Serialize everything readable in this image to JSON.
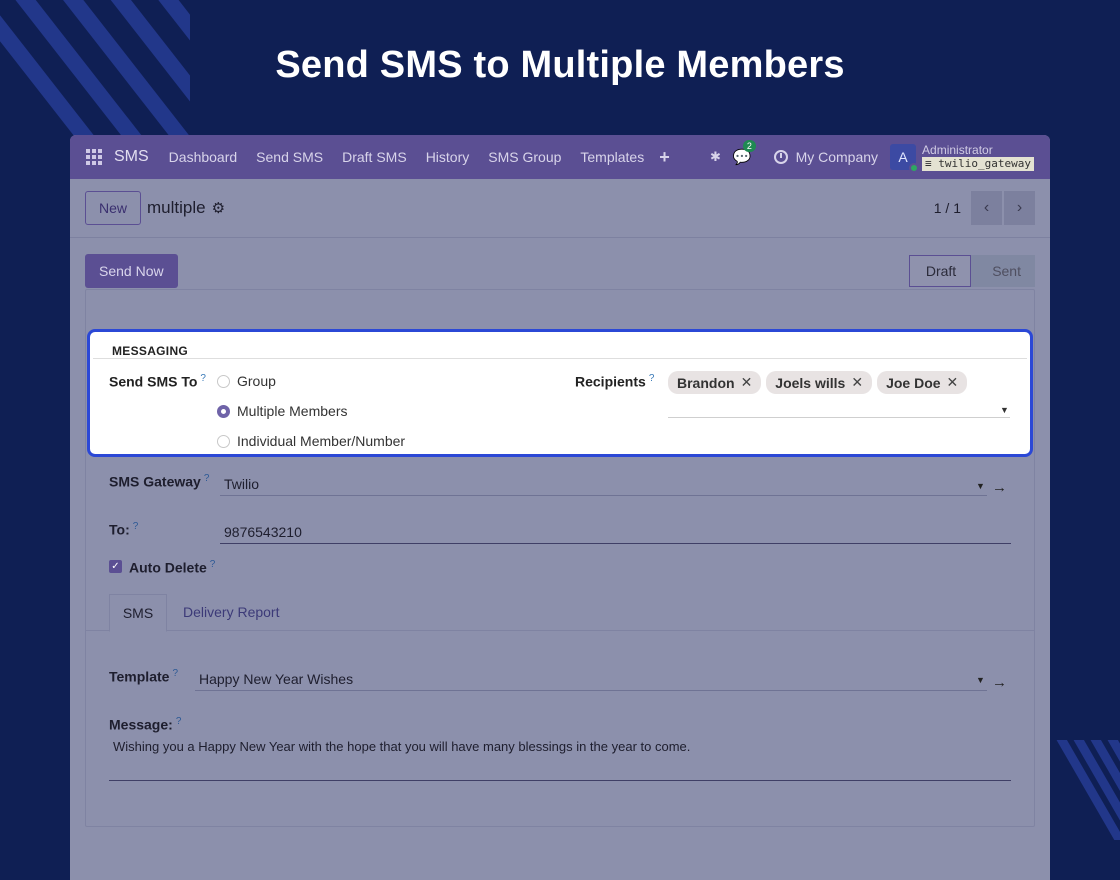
{
  "hero": {
    "title": "Send SMS to Multiple Members"
  },
  "navbar": {
    "brand": "SMS",
    "items": [
      "Dashboard",
      "Send SMS",
      "Draft SMS",
      "History",
      "SMS Group",
      "Templates"
    ],
    "plus": "+",
    "chat_count": "2",
    "company": "My Company",
    "avatar_letter": "A",
    "user_name": "Administrator",
    "database": "twilio_gateway"
  },
  "control": {
    "new_label": "New",
    "record_name": "multiple",
    "pager": "1 / 1"
  },
  "statusbar": {
    "send_label": "Send Now",
    "stages": [
      "Draft",
      "Sent"
    ]
  },
  "messaging": {
    "section_title": "MESSAGING",
    "send_to_label": "Send SMS To",
    "options": [
      "Group",
      "Multiple Members",
      "Individual Member/Number"
    ],
    "selected_option": "Multiple Members",
    "recipients_label": "Recipients",
    "recipients": [
      "Brandon",
      "Joels wills",
      "Joe Doe"
    ]
  },
  "form": {
    "gateway_label": "SMS Gateway",
    "gateway_value": "Twilio",
    "to_label": "To:",
    "to_value": "9876543210",
    "auto_delete_label": "Auto Delete",
    "auto_delete_checked": true
  },
  "tabs": [
    "SMS",
    "Delivery Report"
  ],
  "sms_tab": {
    "template_label": "Template",
    "template_value": "Happy New Year Wishes",
    "message_label": "Message:",
    "message_value": "Wishing you a Happy New Year with the hope that you will have many blessings in the year to come."
  },
  "colors": {
    "background": "#0f1f54",
    "navbar": "#5b4f93",
    "highlight_border": "#2b48d6"
  }
}
